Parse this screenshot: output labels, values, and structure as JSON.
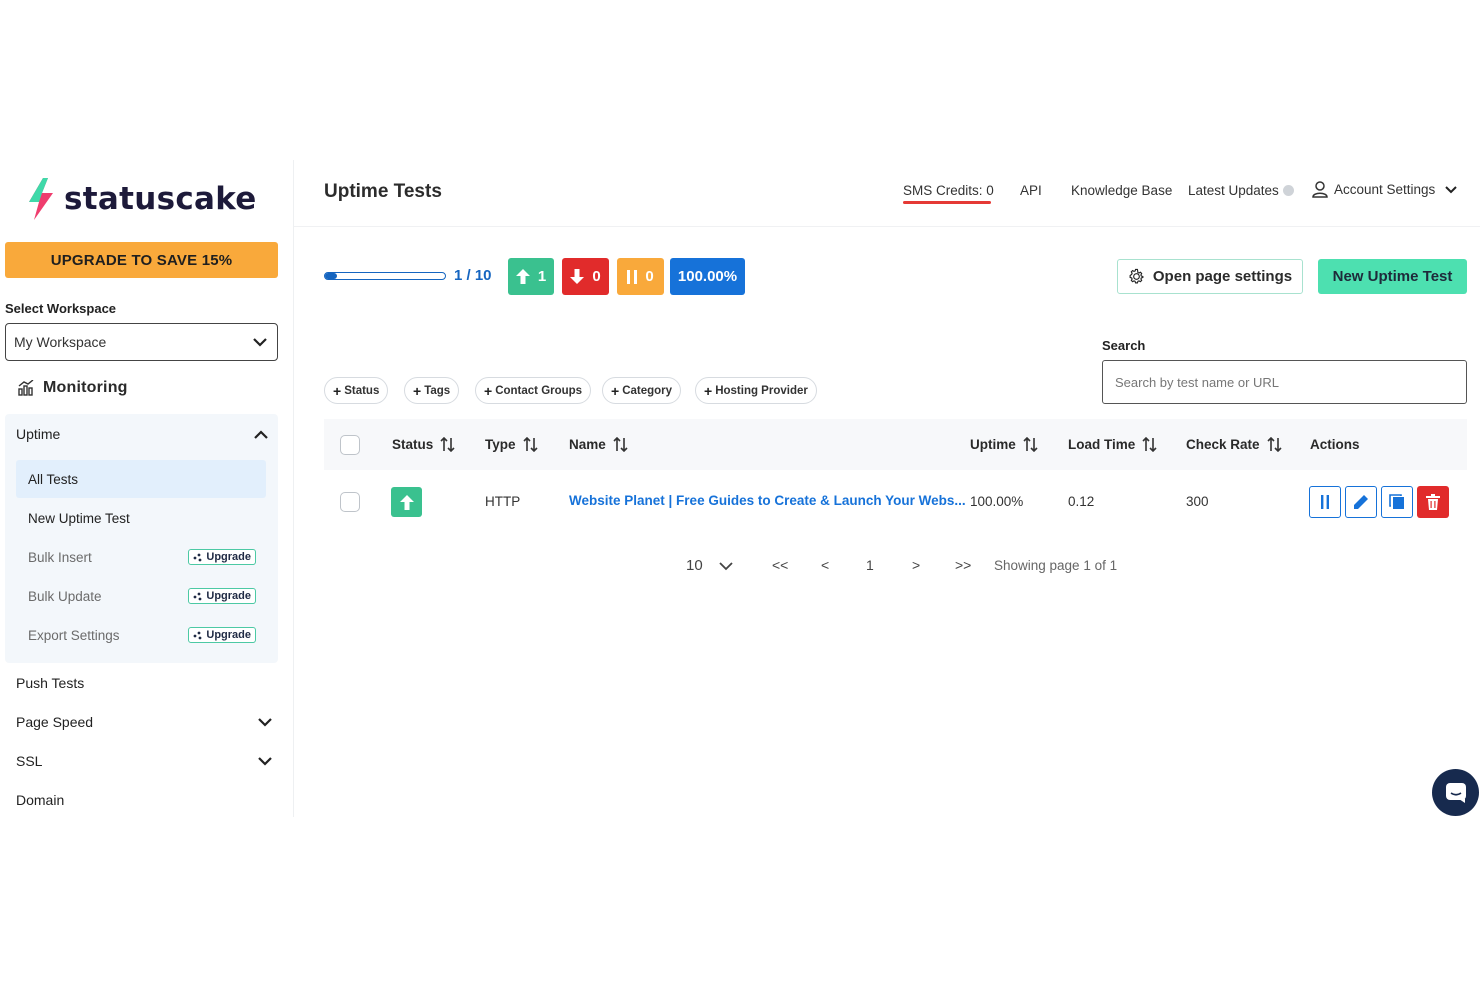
{
  "brand": {
    "name": "statuscake",
    "logo_icon": "lightning-bolt-icon"
  },
  "sidebar": {
    "upgrade_banner": "UPGRADE TO SAVE 15%",
    "workspace_label": "Select Workspace",
    "workspace_value": "My Workspace",
    "section_title": "Monitoring",
    "uptime_label": "Uptime",
    "uptime_items": [
      {
        "label": "All Tests",
        "active": true
      },
      {
        "label": "New Uptime Test"
      },
      {
        "label": "Bulk Insert",
        "badge": "Upgrade"
      },
      {
        "label": "Bulk Update",
        "badge": "Upgrade"
      },
      {
        "label": "Export Settings",
        "badge": "Upgrade"
      }
    ],
    "nav": [
      {
        "label": "Push Tests"
      },
      {
        "label": "Page Speed",
        "expandable": true
      },
      {
        "label": "SSL",
        "expandable": true
      },
      {
        "label": "Domain"
      }
    ]
  },
  "header": {
    "title": "Uptime Tests",
    "sms_credits": "SMS Credits: 0",
    "api": "API",
    "knowledge_base": "Knowledge Base",
    "latest_updates": "Latest Updates",
    "account_settings": "Account Settings"
  },
  "summary": {
    "usage_text": "1 / 10",
    "usage_fraction": 0.1,
    "up_count": "1",
    "down_count": "0",
    "paused_count": "0",
    "uptime_pct": "100.00%"
  },
  "buttons": {
    "open_page_settings": "Open page settings",
    "new_uptime_test": "New Uptime Test"
  },
  "filters": [
    "Status",
    "Tags",
    "Contact Groups",
    "Category",
    "Hosting Provider"
  ],
  "search": {
    "label": "Search",
    "placeholder": "Search by test name or URL"
  },
  "table": {
    "columns": [
      "Status",
      "Type",
      "Name",
      "Uptime",
      "Load Time",
      "Check Rate",
      "Actions"
    ],
    "rows": [
      {
        "status": "up",
        "type": "HTTP",
        "name": "Website Planet | Free Guides to Create & Launch Your Webs...",
        "uptime": "100.00%",
        "load_time": "0.12",
        "check_rate": "300"
      }
    ]
  },
  "pagination": {
    "page_size": "10",
    "first": "<<",
    "prev": "<",
    "current": "1",
    "next": ">",
    "last": ">>",
    "showing": "Showing page 1 of 1"
  },
  "colors": {
    "accent_green": "#3ac18f",
    "mint_button": "#4de0b0",
    "danger_red": "#e12b2b",
    "warning_orange": "#f9a93b",
    "primary_blue": "#1672d9"
  }
}
